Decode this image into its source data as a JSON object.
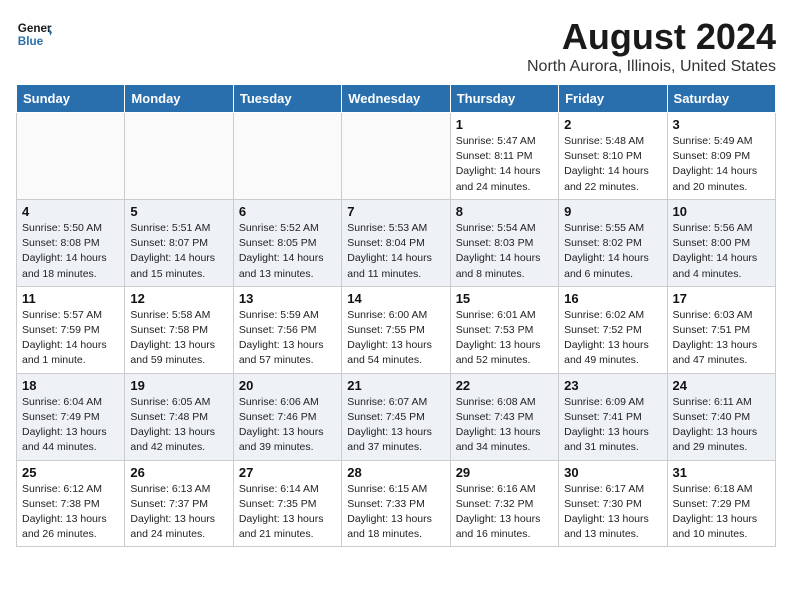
{
  "header": {
    "logo_line1": "General",
    "logo_line2": "Blue",
    "main_title": "August 2024",
    "subtitle": "North Aurora, Illinois, United States"
  },
  "days_of_week": [
    "Sunday",
    "Monday",
    "Tuesday",
    "Wednesday",
    "Thursday",
    "Friday",
    "Saturday"
  ],
  "weeks": [
    [
      {
        "day": "",
        "info": ""
      },
      {
        "day": "",
        "info": ""
      },
      {
        "day": "",
        "info": ""
      },
      {
        "day": "",
        "info": ""
      },
      {
        "day": "1",
        "info": "Sunrise: 5:47 AM\nSunset: 8:11 PM\nDaylight: 14 hours\nand 24 minutes."
      },
      {
        "day": "2",
        "info": "Sunrise: 5:48 AM\nSunset: 8:10 PM\nDaylight: 14 hours\nand 22 minutes."
      },
      {
        "day": "3",
        "info": "Sunrise: 5:49 AM\nSunset: 8:09 PM\nDaylight: 14 hours\nand 20 minutes."
      }
    ],
    [
      {
        "day": "4",
        "info": "Sunrise: 5:50 AM\nSunset: 8:08 PM\nDaylight: 14 hours\nand 18 minutes."
      },
      {
        "day": "5",
        "info": "Sunrise: 5:51 AM\nSunset: 8:07 PM\nDaylight: 14 hours\nand 15 minutes."
      },
      {
        "day": "6",
        "info": "Sunrise: 5:52 AM\nSunset: 8:05 PM\nDaylight: 14 hours\nand 13 minutes."
      },
      {
        "day": "7",
        "info": "Sunrise: 5:53 AM\nSunset: 8:04 PM\nDaylight: 14 hours\nand 11 minutes."
      },
      {
        "day": "8",
        "info": "Sunrise: 5:54 AM\nSunset: 8:03 PM\nDaylight: 14 hours\nand 8 minutes."
      },
      {
        "day": "9",
        "info": "Sunrise: 5:55 AM\nSunset: 8:02 PM\nDaylight: 14 hours\nand 6 minutes."
      },
      {
        "day": "10",
        "info": "Sunrise: 5:56 AM\nSunset: 8:00 PM\nDaylight: 14 hours\nand 4 minutes."
      }
    ],
    [
      {
        "day": "11",
        "info": "Sunrise: 5:57 AM\nSunset: 7:59 PM\nDaylight: 14 hours\nand 1 minute."
      },
      {
        "day": "12",
        "info": "Sunrise: 5:58 AM\nSunset: 7:58 PM\nDaylight: 13 hours\nand 59 minutes."
      },
      {
        "day": "13",
        "info": "Sunrise: 5:59 AM\nSunset: 7:56 PM\nDaylight: 13 hours\nand 57 minutes."
      },
      {
        "day": "14",
        "info": "Sunrise: 6:00 AM\nSunset: 7:55 PM\nDaylight: 13 hours\nand 54 minutes."
      },
      {
        "day": "15",
        "info": "Sunrise: 6:01 AM\nSunset: 7:53 PM\nDaylight: 13 hours\nand 52 minutes."
      },
      {
        "day": "16",
        "info": "Sunrise: 6:02 AM\nSunset: 7:52 PM\nDaylight: 13 hours\nand 49 minutes."
      },
      {
        "day": "17",
        "info": "Sunrise: 6:03 AM\nSunset: 7:51 PM\nDaylight: 13 hours\nand 47 minutes."
      }
    ],
    [
      {
        "day": "18",
        "info": "Sunrise: 6:04 AM\nSunset: 7:49 PM\nDaylight: 13 hours\nand 44 minutes."
      },
      {
        "day": "19",
        "info": "Sunrise: 6:05 AM\nSunset: 7:48 PM\nDaylight: 13 hours\nand 42 minutes."
      },
      {
        "day": "20",
        "info": "Sunrise: 6:06 AM\nSunset: 7:46 PM\nDaylight: 13 hours\nand 39 minutes."
      },
      {
        "day": "21",
        "info": "Sunrise: 6:07 AM\nSunset: 7:45 PM\nDaylight: 13 hours\nand 37 minutes."
      },
      {
        "day": "22",
        "info": "Sunrise: 6:08 AM\nSunset: 7:43 PM\nDaylight: 13 hours\nand 34 minutes."
      },
      {
        "day": "23",
        "info": "Sunrise: 6:09 AM\nSunset: 7:41 PM\nDaylight: 13 hours\nand 31 minutes."
      },
      {
        "day": "24",
        "info": "Sunrise: 6:11 AM\nSunset: 7:40 PM\nDaylight: 13 hours\nand 29 minutes."
      }
    ],
    [
      {
        "day": "25",
        "info": "Sunrise: 6:12 AM\nSunset: 7:38 PM\nDaylight: 13 hours\nand 26 minutes."
      },
      {
        "day": "26",
        "info": "Sunrise: 6:13 AM\nSunset: 7:37 PM\nDaylight: 13 hours\nand 24 minutes."
      },
      {
        "day": "27",
        "info": "Sunrise: 6:14 AM\nSunset: 7:35 PM\nDaylight: 13 hours\nand 21 minutes."
      },
      {
        "day": "28",
        "info": "Sunrise: 6:15 AM\nSunset: 7:33 PM\nDaylight: 13 hours\nand 18 minutes."
      },
      {
        "day": "29",
        "info": "Sunrise: 6:16 AM\nSunset: 7:32 PM\nDaylight: 13 hours\nand 16 minutes."
      },
      {
        "day": "30",
        "info": "Sunrise: 6:17 AM\nSunset: 7:30 PM\nDaylight: 13 hours\nand 13 minutes."
      },
      {
        "day": "31",
        "info": "Sunrise: 6:18 AM\nSunset: 7:29 PM\nDaylight: 13 hours\nand 10 minutes."
      }
    ]
  ]
}
